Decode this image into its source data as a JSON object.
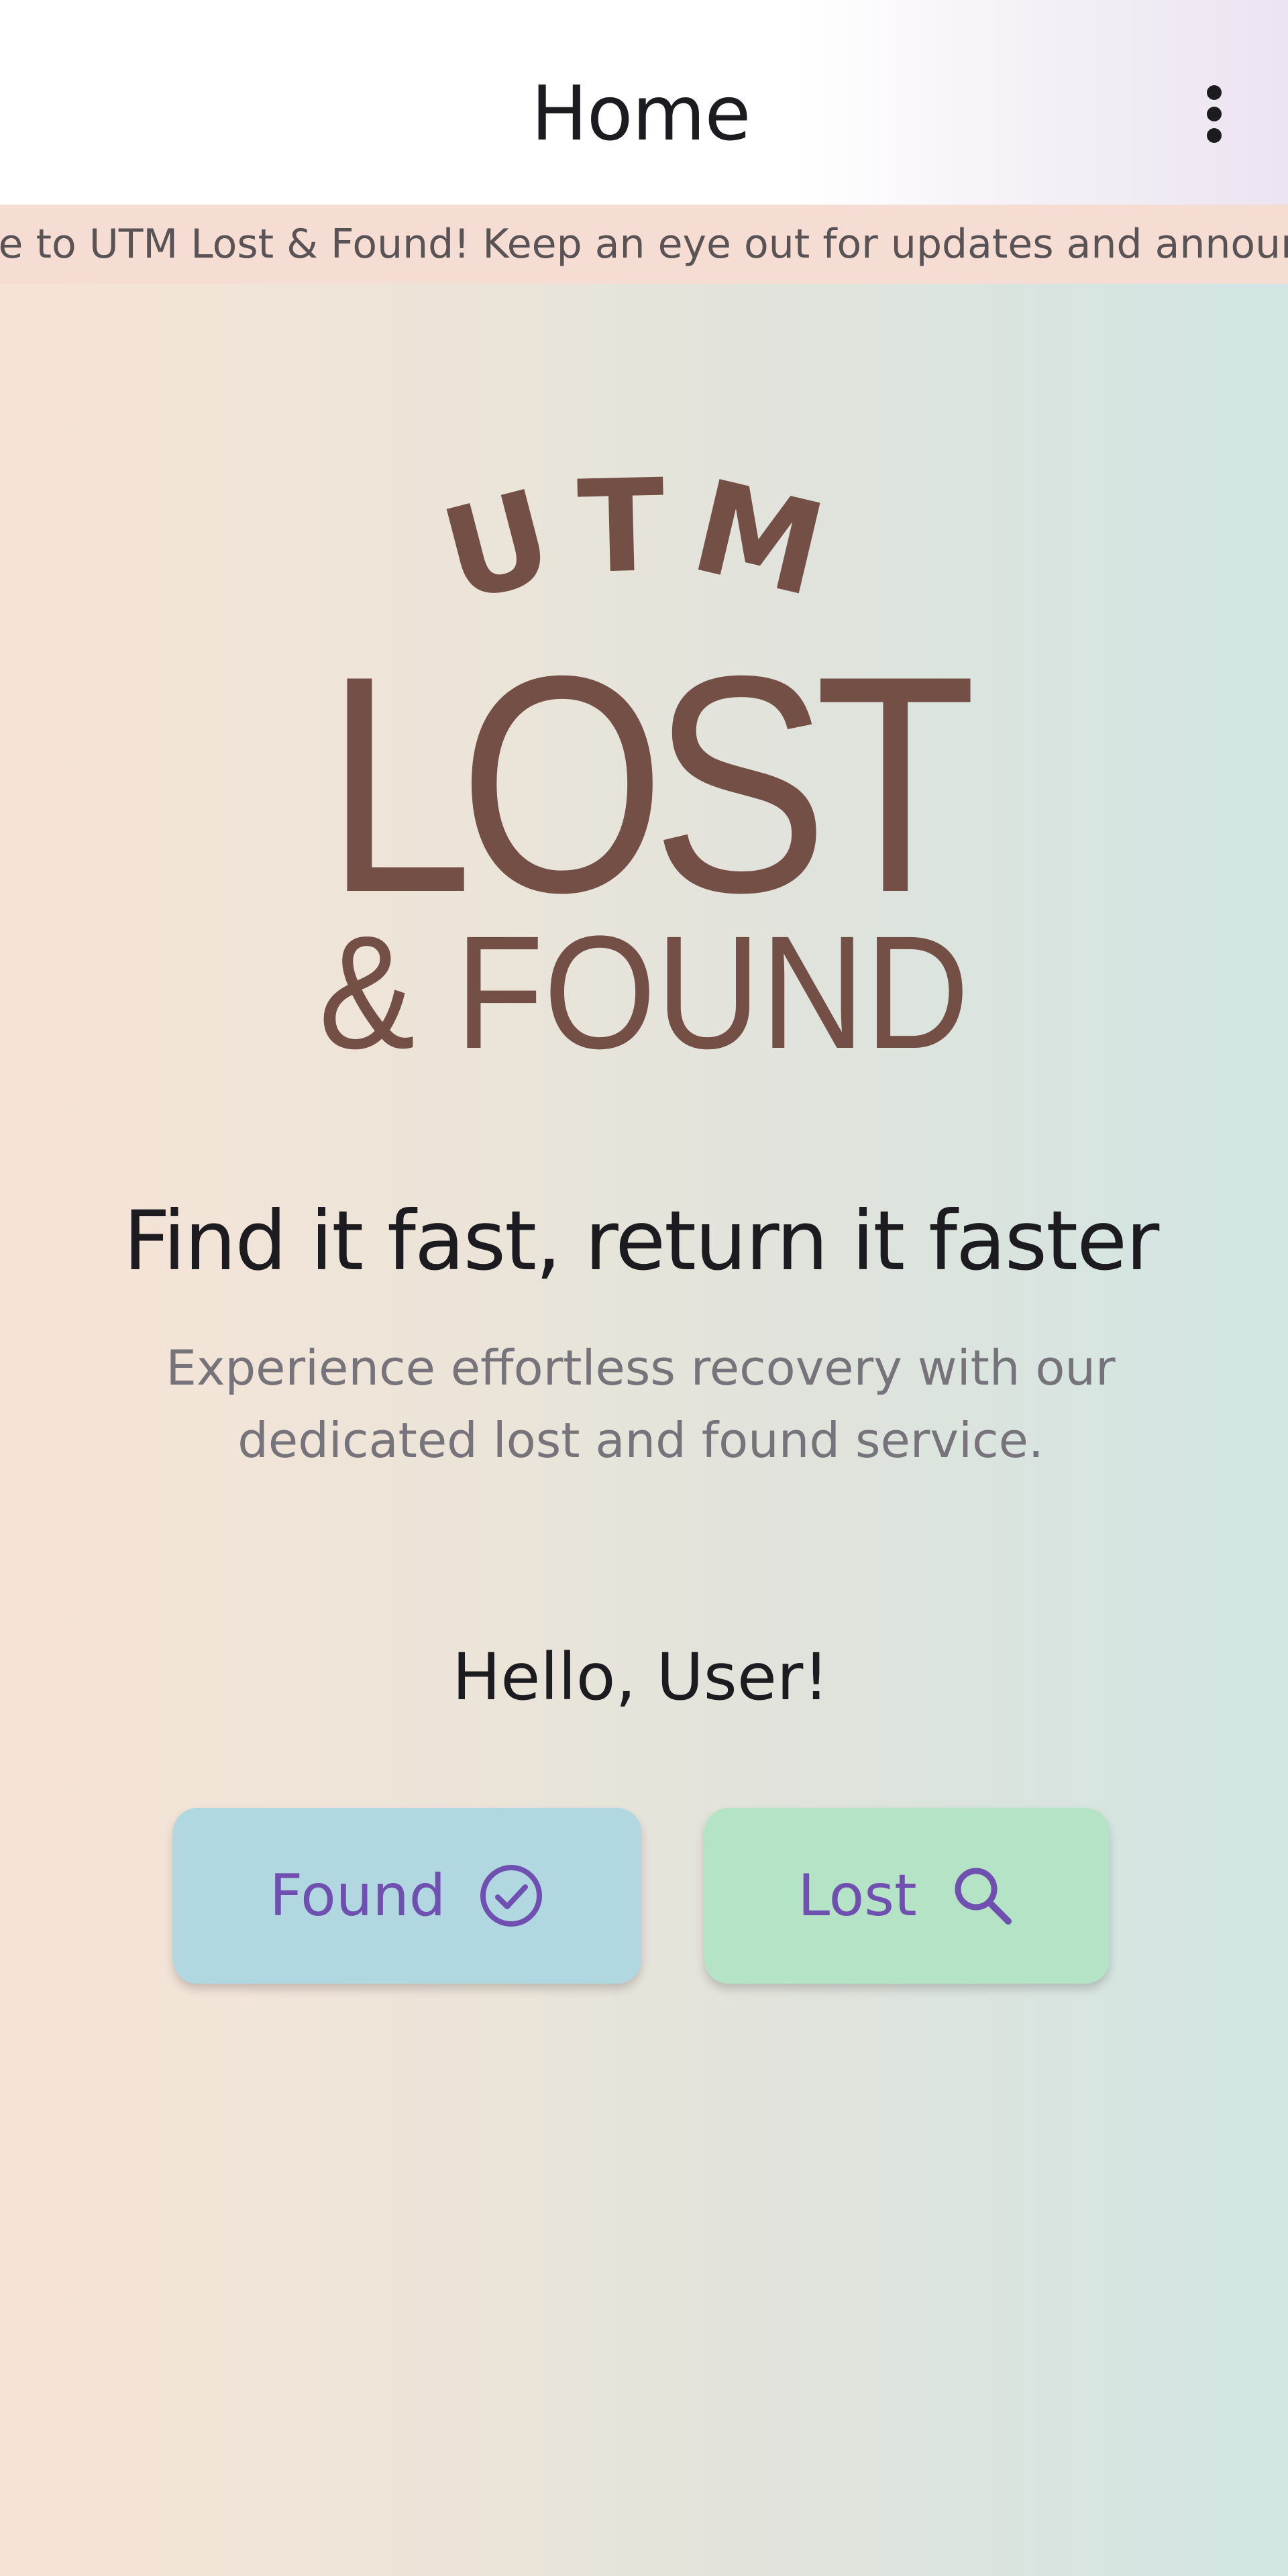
{
  "app_bar": {
    "title": "Home",
    "menu_icon": "more-vert-icon"
  },
  "announcement": {
    "text": "Welcome to UTM Lost & Found! Keep an eye out for updates and announcements."
  },
  "logo": {
    "line1": "UTM",
    "line2": "LOST",
    "line3": "& FOUND",
    "color": "#744f45"
  },
  "hero": {
    "headline": "Find it fast, return it faster",
    "subtext": "Experience effortless recovery with our dedicated lost and found service."
  },
  "greeting": "Hello, User!",
  "buttons": {
    "found_label": "Found",
    "found_icon": "check-circle-icon",
    "lost_label": "Lost",
    "lost_icon": "search-icon"
  },
  "colors": {
    "accent": "#6f4fb0",
    "found_bg": "#b1d8e0",
    "lost_bg": "#b5e3c6",
    "announcement_bg": "#f6ddd3"
  }
}
